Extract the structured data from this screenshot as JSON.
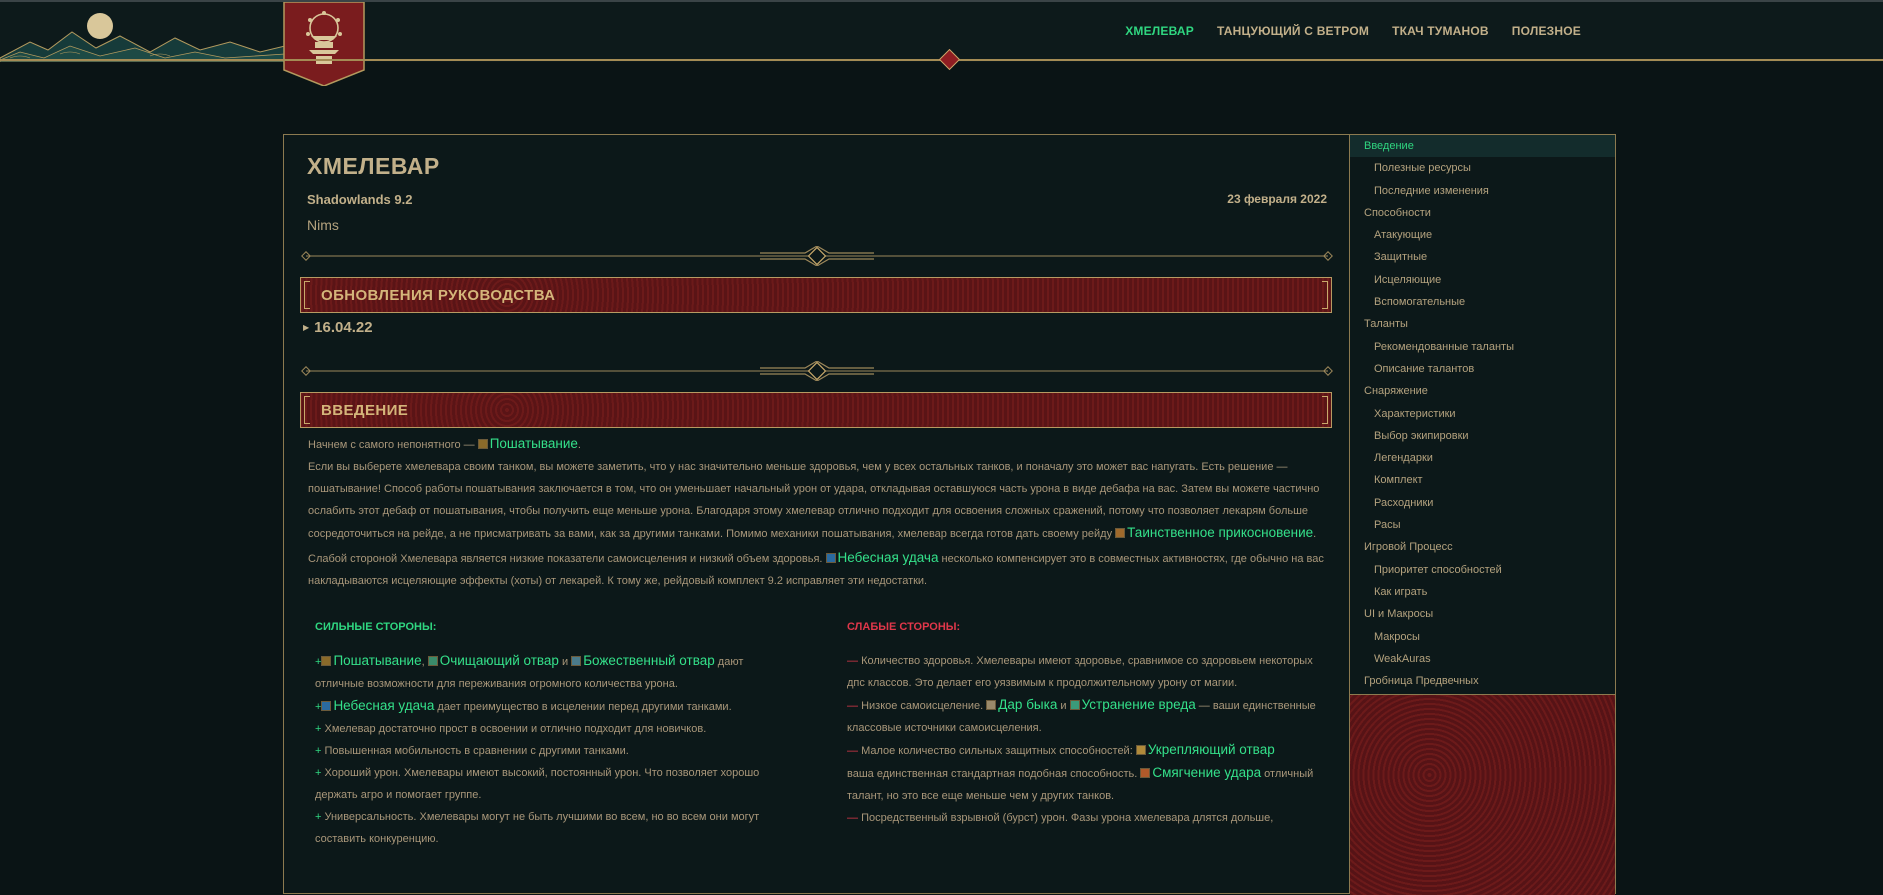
{
  "header": {
    "nav": [
      {
        "label": "ХМЕЛЕВАР",
        "active": true
      },
      {
        "label": "ТАНЦУЮЩИЙ С ВЕТРОМ",
        "active": false
      },
      {
        "label": "ТКАЧ ТУМАНОВ",
        "active": false
      },
      {
        "label": "ПОЛЕЗНОЕ",
        "active": false
      }
    ]
  },
  "article": {
    "title": "ХМЕЛЕВАР",
    "patch": "Shadowlands 9.2",
    "date": "23 февраля 2022",
    "author": "Nims",
    "updates_heading": "ОБНОВЛЕНИЯ РУКОВОДСТВА",
    "update_date": "16.04.22",
    "intro_heading": "ВВЕДЕНИЕ",
    "intro": {
      "p1_text": "Начнем с самого непонятного — ",
      "p1_spell": "Пошатывание",
      "p1_end": ".",
      "p2_text": "Если вы выберете хмелевара своим танком, вы можете заметить, что у нас значительно меньше здоровья, чем у всех остальных танков, и поначалу это может вас напугать. Есть решение — пошатывание! Способ работы пошатывания заключается в том, что он уменьшает начальный урон от удара, откладывая оставшуюся часть урона в виде дебафа на вас. Затем вы можете частично ослабить этот дебаф от пошатывания, чтобы получить еще меньше урона. Благодаря этому хмелевар отлично подходит для освоения сложных сражений, потому что позволяет лекарям больше сосредоточиться на рейде, а не присматривать за вами, как за другими танками. Помимо механики пошатывания, хмелевар всегда готов дать своему рейду ",
      "p2_spell": "Таинственное прикосновение",
      "p2_end": ".",
      "p3_text": "Слабой стороной Хмелевара является низкие показатели самоисцеления и низкий объем здоровья. ",
      "p3_spell": "Небесная удача",
      "p3_end": " несколько компенсирует это в совместных активностях, где обычно на вас  накладываются исцеляющие эффекты (хоты) от лекарей. К тому же, рейдовый комплект 9.2 исправляет эти недостатки."
    },
    "strengths": {
      "heading": "СИЛЬНЫЕ СТОРОНЫ:",
      "items": [
        {
          "spells": [
            "Пошатывание",
            "Очищающий отвар",
            "Божественный отвар"
          ],
          "sep1": ", ",
          "sep2": " и ",
          "text": " дают отличные возможности для переживания огромного количества урона."
        },
        {
          "spell": "Небесная удача",
          "text": " дает преимущество в исцелении перед другими танками."
        },
        {
          "text": "Хмелевар достаточно прост в освоении и отлично подходит для новичков."
        },
        {
          "text": "Повышенная мобильность в сравнении с другими танками."
        },
        {
          "text": "Хороший урон. Хмелевары имеют высокий, постоянный урон. Что позволяет хорошо держать агро и помогает группе."
        },
        {
          "text": "Универсальность. Хмелевары могут не быть лучшими во всем, но во всем они могут составить конкуренцию."
        }
      ]
    },
    "weaknesses": {
      "heading": "СЛАБЫЕ СТОРОНЫ:",
      "items": [
        {
          "text": "Количество здоровья. Хмелевары имеют здоровье, сравнимое со здоровьем некоторых дпс классов. Это делает его уязвимым к продолжительному урону от магии."
        },
        {
          "text_a": "Низкое самоисцеление. ",
          "spell1": "Дар быка",
          "sep": " и ",
          "spell2": "Устранение вреда",
          "text_b": " — ваши единственные классовые источники самоисцеления."
        },
        {
          "text_a": "Малое количество сильных защитных способностей: ",
          "spell1": "Укрепляющий отвар",
          "text_b": " ваша единственная стандартная подобная способность. ",
          "spell2": "Смягчение удара",
          "text_c": " отличный талант, но это все еще меньше чем у других танков."
        },
        {
          "text": "Посредственный взрывной (бурст) урон. Фазы урона хмелевара длятся дольше,"
        }
      ]
    }
  },
  "toc": [
    {
      "label": "Введение",
      "level": 0,
      "active": true
    },
    {
      "label": "Полезные ресурсы",
      "level": 1
    },
    {
      "label": "Последние изменения",
      "level": 1
    },
    {
      "label": "Способности",
      "level": 0
    },
    {
      "label": "Атакующие",
      "level": 1
    },
    {
      "label": "Защитные",
      "level": 1
    },
    {
      "label": "Исцеляющие",
      "level": 1
    },
    {
      "label": "Вспомогательные",
      "level": 1
    },
    {
      "label": "Таланты",
      "level": 0
    },
    {
      "label": "Рекомендованные таланты",
      "level": 1
    },
    {
      "label": "Описание талантов",
      "level": 1
    },
    {
      "label": "Снаряжение",
      "level": 0
    },
    {
      "label": "Характеристики",
      "level": 1
    },
    {
      "label": "Выбор экипировки",
      "level": 1
    },
    {
      "label": "Легендарки",
      "level": 1
    },
    {
      "label": "Комплект",
      "level": 1
    },
    {
      "label": "Расходники",
      "level": 1
    },
    {
      "label": "Расы",
      "level": 1
    },
    {
      "label": "Игровой Процесс",
      "level": 0
    },
    {
      "label": "Приоритет способностей",
      "level": 1
    },
    {
      "label": "Как играть",
      "level": 1
    },
    {
      "label": "UI и Макросы",
      "level": 0
    },
    {
      "label": "Макросы",
      "level": 1
    },
    {
      "label": "WeakAuras",
      "level": 1
    },
    {
      "label": "Гробница Предвечных",
      "level": 0
    }
  ],
  "colors": {
    "accent_green": "#2fd680",
    "spell_green": "#34e08a",
    "gold": "#c2b08a",
    "danger_red": "#e0374a",
    "banner_red": "#6c1a1a"
  }
}
